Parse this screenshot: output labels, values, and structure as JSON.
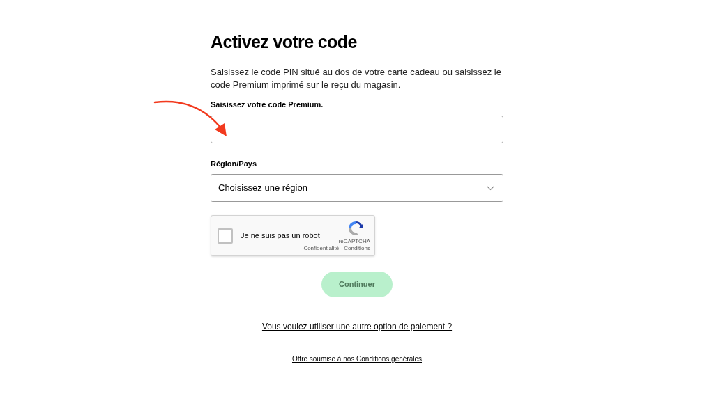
{
  "title": "Activez votre code",
  "intro": "Saisissez le code PIN situé au dos de votre carte cadeau ou saisissez le code Premium imprimé sur le reçu du magasin.",
  "code_field": {
    "label": "Saisissez votre code Premium."
  },
  "region_field": {
    "label": "Région/Pays",
    "value": "Choisissez une région"
  },
  "captcha": {
    "label": "Je ne suis pas un robot",
    "checked": false,
    "brand": "reCAPTCHA",
    "links": "Confidentialité - Conditions"
  },
  "continue_button": {
    "label": "Continuer",
    "disabled": true
  },
  "links": [
    "Vous voulez utiliser une autre option de paiement ?",
    "Offre soumise à nos Conditions générales"
  ],
  "annotation": {
    "kind": "arrow"
  }
}
